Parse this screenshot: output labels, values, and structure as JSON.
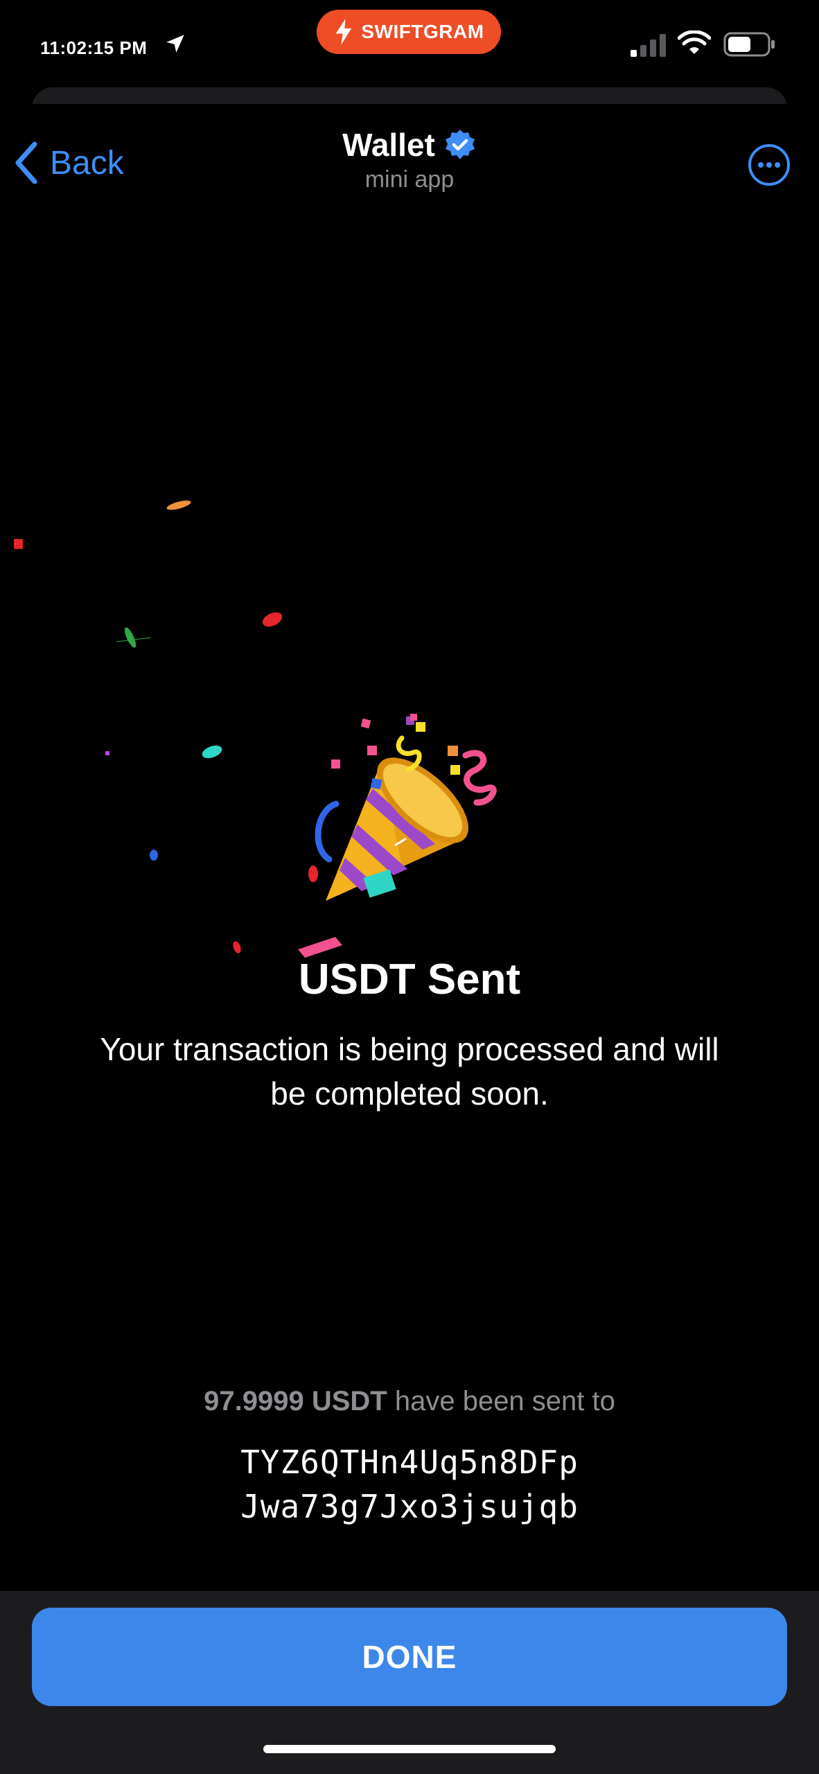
{
  "status_bar": {
    "time": "11:02:15 PM",
    "badge_label": "SWIFTGRAM",
    "badge_color": "#ee4d26",
    "icons": [
      "location-arrow-icon",
      "signal-icon",
      "wifi-icon",
      "battery-icon"
    ]
  },
  "nav": {
    "back_label": "Back",
    "title": "Wallet",
    "subtitle": "mini app",
    "accent_color": "#3e8ef7"
  },
  "content": {
    "title": "USDT Sent",
    "description": "Your transaction is being processed and will be completed soon.",
    "amount": "97.9999 USDT",
    "sent_suffix": "have been sent to",
    "address_line1": "TYZ6QTHn4Uq5n8DFp",
    "address_line2": "Jwa73g7Jxo3jsujqb"
  },
  "footer": {
    "done_label": "DONE",
    "button_color": "#3e87ea"
  }
}
